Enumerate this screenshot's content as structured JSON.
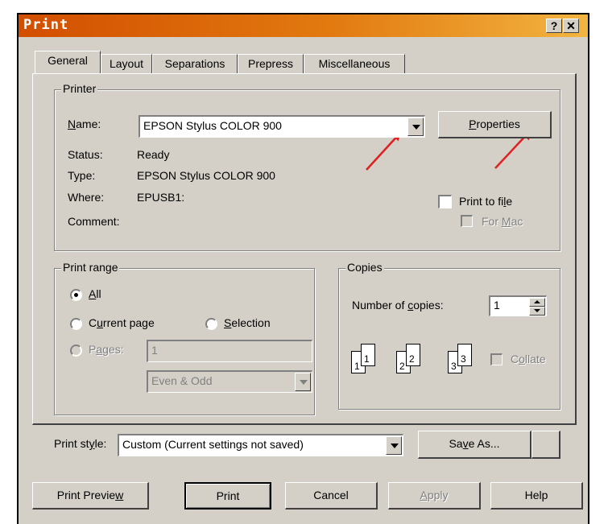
{
  "window": {
    "title": "Print",
    "help_btn": "?",
    "close_btn": "✕"
  },
  "tabs": [
    "General",
    "Layout",
    "Separations",
    "Prepress",
    "Miscellaneous"
  ],
  "printer": {
    "group_title": "Printer",
    "name_label": "Name:",
    "name_value": "EPSON Stylus COLOR 900",
    "properties_label": "Properties",
    "status_label": "Status:",
    "status_value": "Ready",
    "type_label": "Type:",
    "type_value": "EPSON Stylus COLOR 900",
    "where_label": "Where:",
    "where_value": "EPUSB1:",
    "comment_label": "Comment:",
    "print_to_file": "Print to file",
    "for_mac": "For Mac"
  },
  "print_range": {
    "group_title": "Print range",
    "all": "All",
    "current_page": "Current page",
    "selection": "Selection",
    "pages": "Pages:",
    "pages_value": "1",
    "even_odd": "Even & Odd"
  },
  "copies": {
    "group_title": "Copies",
    "number_label": "Number of copies:",
    "number_value": "1",
    "collate": "Collate",
    "pages_icons": [
      "1",
      "1",
      "2",
      "2",
      "3",
      "3"
    ]
  },
  "print_style": {
    "label": "Print style:",
    "value": "Custom (Current settings not saved)",
    "save_as": "Save As..."
  },
  "buttons": {
    "preview": "Print Preview",
    "print": "Print",
    "cancel": "Cancel",
    "apply": "Apply",
    "help": "Help"
  },
  "colors": {
    "titlebar_start": "#d24e00",
    "titlebar_end": "#f2b440",
    "dialog_bg": "#d4d0c8",
    "annotation_arrow": "#e02020"
  },
  "icons": {
    "dropdown": "triangle-down-icon",
    "spinner_up": "triangle-up-icon",
    "spinner_down": "triangle-down-icon"
  }
}
